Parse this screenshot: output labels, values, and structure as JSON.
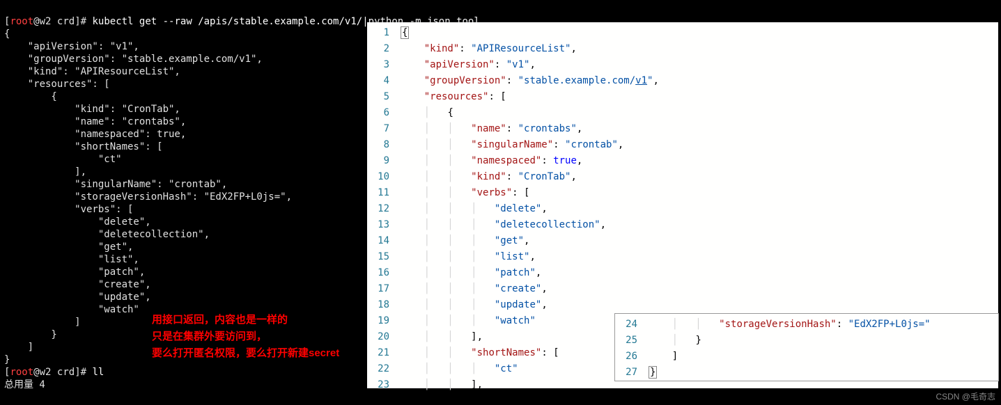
{
  "terminal": {
    "prompt_user": "root",
    "prompt_host": "w2",
    "prompt_dir": "crd",
    "cmd1": "kubectl get --raw /apis/stable.example.com/v1/|python -m json.tool",
    "json_lines": [
      "{",
      "    \"apiVersion\": \"v1\",",
      "    \"groupVersion\": \"stable.example.com/v1\",",
      "    \"kind\": \"APIResourceList\",",
      "    \"resources\": [",
      "        {",
      "            \"kind\": \"CronTab\",",
      "            \"name\": \"crontabs\",",
      "            \"namespaced\": true,",
      "            \"shortNames\": [",
      "                \"ct\"",
      "            ],",
      "            \"singularName\": \"crontab\",",
      "            \"storageVersionHash\": \"EdX2FP+L0js=\",",
      "            \"verbs\": [",
      "                \"delete\",",
      "                \"deletecollection\",",
      "                \"get\",",
      "                \"list\",",
      "                \"patch\",",
      "                \"create\",",
      "                \"update\",",
      "                \"watch\"",
      "            ]",
      "        }",
      "    ]",
      "}"
    ],
    "cmd2": "ll",
    "output2": "总用量 4"
  },
  "annotation": {
    "line1": "用接口返回，内容也是一样的",
    "line2": "只是在集群外要访问到，",
    "line3": "要么打开匿名权限，要么打开新建secret"
  },
  "editor": {
    "line_numbers": [
      "1",
      "2",
      "3",
      "4",
      "5",
      "6",
      "7",
      "8",
      "9",
      "10",
      "11",
      "12",
      "13",
      "14",
      "15",
      "16",
      "17",
      "18",
      "19",
      "20",
      "21",
      "22",
      "23"
    ],
    "entries": {
      "l1_open": "{",
      "l2_key": "\"kind\"",
      "l2_val": "\"APIResourceList\"",
      "l3_key": "\"apiVersion\"",
      "l3_val": "\"v1\"",
      "l4_key": "\"groupVersion\"",
      "l4_val_a": "\"stable.example.com/",
      "l4_val_b": "v1",
      "l4_val_c": "\"",
      "l5_key": "\"resources\"",
      "l7_key": "\"name\"",
      "l7_val": "\"crontabs\"",
      "l8_key": "\"singularName\"",
      "l8_val": "\"crontab\"",
      "l9_key": "\"namespaced\"",
      "l9_val": "true",
      "l10_key": "\"kind\"",
      "l10_val": "\"CronTab\"",
      "l11_key": "\"verbs\"",
      "l12": "\"delete\"",
      "l13": "\"deletecollection\"",
      "l14": "\"get\"",
      "l15": "\"list\"",
      "l16": "\"patch\"",
      "l17": "\"create\"",
      "l18": "\"update\"",
      "l19": "\"watch\"",
      "l21_key": "\"shortNames\"",
      "l22": "\"ct\""
    }
  },
  "inset": {
    "line_numbers": [
      "24",
      "25",
      "26",
      "27"
    ],
    "l24_key": "\"storageVersionHash\"",
    "l24_val": "\"EdX2FP+L0js=\"",
    "l25": "}",
    "l26": "]",
    "l27": "}"
  },
  "watermark": "CSDN @毛奇志"
}
